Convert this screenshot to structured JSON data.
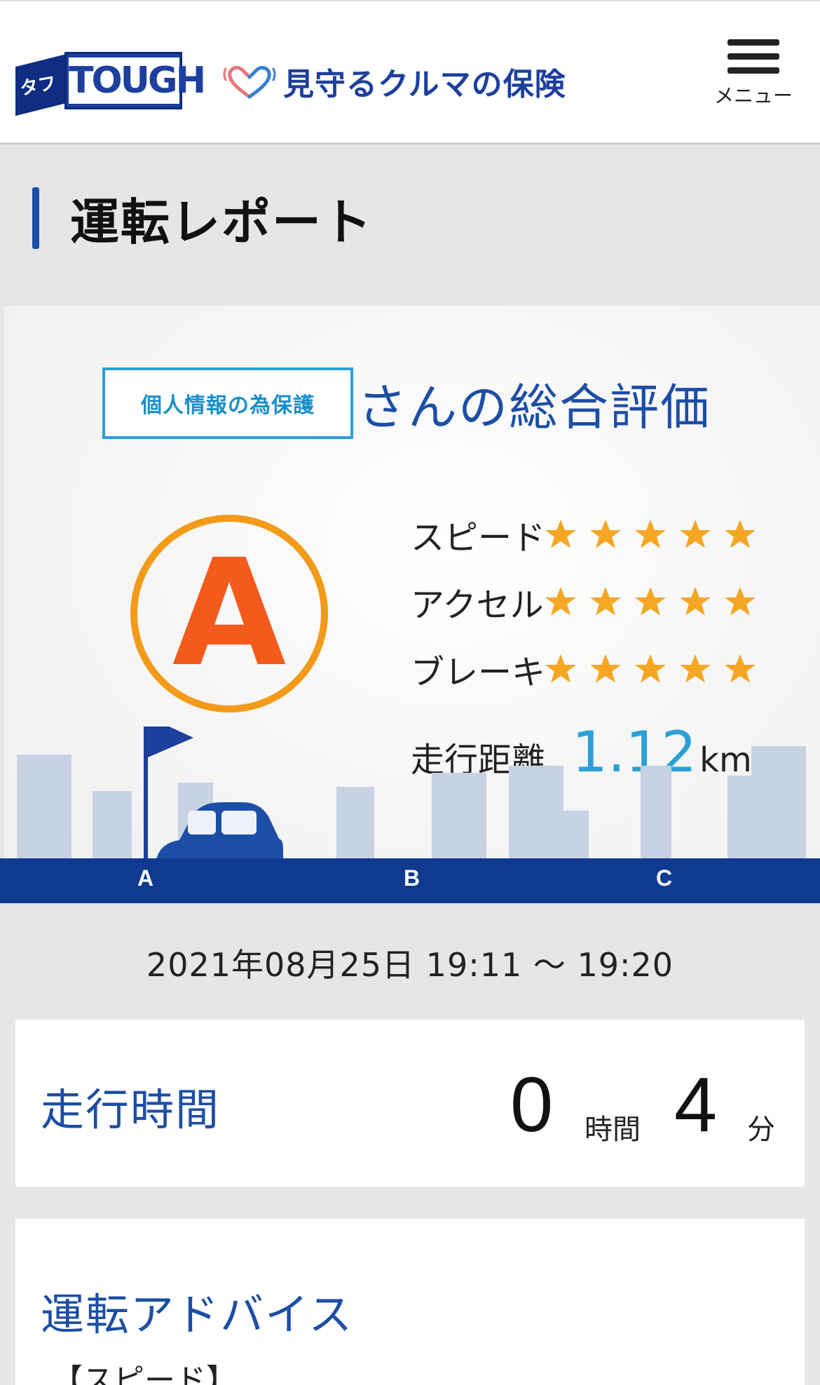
{
  "header": {
    "logo_side_text": "タフ",
    "logo_text": "TOUGH",
    "brand_text": "見守るクルマの保険",
    "menu_label": "メニュー"
  },
  "page": {
    "title": "運転レポート"
  },
  "report": {
    "name_mask": "個人情報の為保護",
    "overall_suffix": "さんの総合評価",
    "grade": "A",
    "ratings": [
      {
        "label": "スピード",
        "stars": 5
      },
      {
        "label": "アクセル",
        "stars": 5
      },
      {
        "label": "ブレーキ",
        "stars": 5
      }
    ],
    "distance_label": "走行距離",
    "distance_value": "1.12",
    "distance_unit": "km",
    "route_points": [
      "A",
      "B",
      "C"
    ]
  },
  "trip": {
    "date_range": "2021年08月25日 19:11 〜 19:20"
  },
  "duration": {
    "label": "走行時間",
    "hours": "0",
    "hours_unit": "時間",
    "minutes": "4",
    "minutes_unit": "分"
  },
  "advice": {
    "title": "運転アドバイス",
    "first_section": "【スピード】"
  },
  "colors": {
    "brand_blue": "#1d4ea5",
    "accent_cyan": "#2ba0d8",
    "grade_orange": "#f45a1c",
    "star_orange": "#f5a623",
    "road_navy": "#0f3a8f"
  }
}
